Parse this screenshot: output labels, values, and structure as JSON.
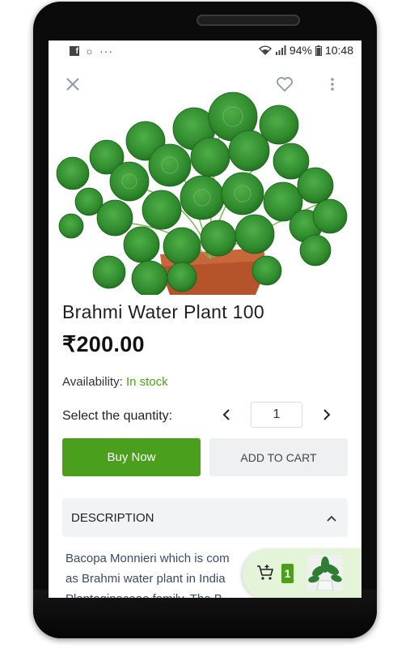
{
  "status_bar": {
    "battery": "94%",
    "time": "10:48"
  },
  "product": {
    "title": "Brahmi Water Plant 100",
    "price": "₹200.00",
    "availability_label": "Availability:",
    "availability_value": "In stock",
    "quantity_label": "Select the quantity:",
    "quantity_value": "1"
  },
  "actions": {
    "buy_now": "Buy Now",
    "add_to_cart": "ADD TO CART"
  },
  "description": {
    "header": "DESCRIPTION",
    "lines": [
      "Bacopa Monnieri which is com",
      "as Brahmi water plant in India",
      "Plantaginaceae family. The B"
    ]
  },
  "cart": {
    "count": "1"
  },
  "icons": {
    "close": "close-icon",
    "favorite": "heart-icon",
    "more": "more-vert-icon",
    "prev": "chevron-left-icon",
    "next": "chevron-right-icon",
    "collapse": "chevron-up-icon",
    "cart": "cart-add-icon"
  },
  "colors": {
    "accent_green": "#4a9f1c",
    "in_stock": "#4aa11a",
    "cart_bg": "#e3f4d8",
    "secondary_button": "#eef0f2"
  }
}
